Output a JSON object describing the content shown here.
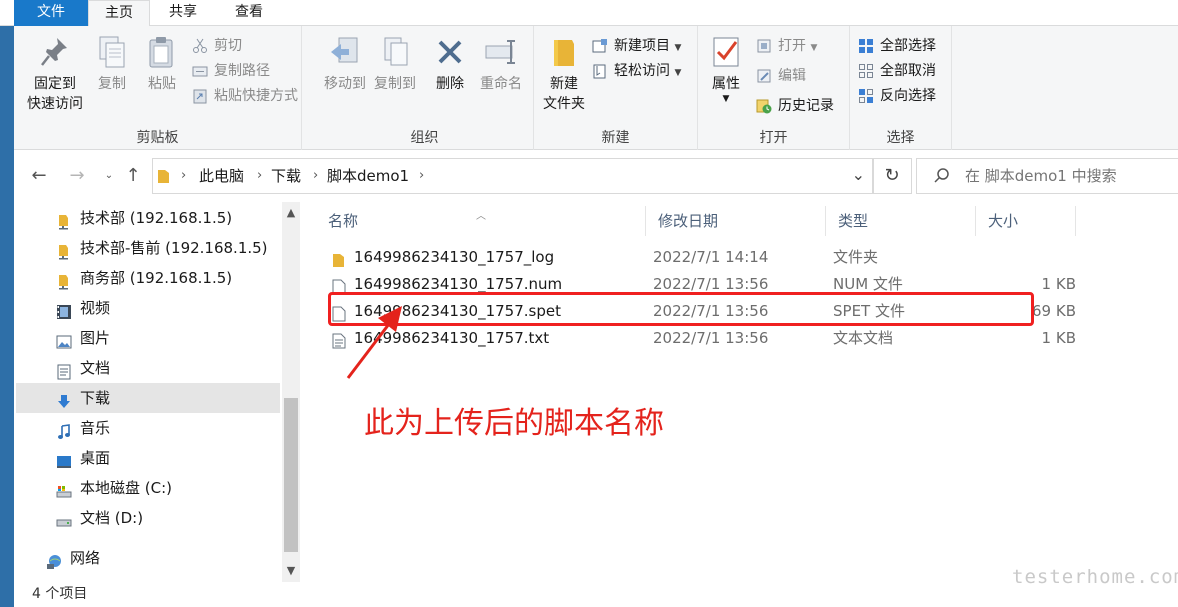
{
  "tabs": {
    "file": "文件",
    "home": "主页",
    "share": "共享",
    "view": "查看"
  },
  "ribbon": {
    "clipboard": {
      "label": "剪贴板",
      "pin": "固定到\n快速访问",
      "pin_l1": "固定到",
      "pin_l2": "快速访问",
      "copy": "复制",
      "paste": "粘贴",
      "cut": "剪切",
      "copy_path": "复制路径",
      "paste_shortcut": "粘贴快捷方式"
    },
    "organize": {
      "label": "组织",
      "move_to": "移动到",
      "copy_to": "复制到",
      "delete": "删除",
      "rename": "重命名"
    },
    "new": {
      "label": "新建",
      "new_folder_l1": "新建",
      "new_folder_l2": "文件夹",
      "new_item": "新建项目",
      "easy_access": "轻松访问"
    },
    "open": {
      "label": "打开",
      "properties": "属性",
      "open": "打开",
      "edit": "编辑",
      "history": "历史记录"
    },
    "select": {
      "label": "选择",
      "select_all": "全部选择",
      "select_none": "全部取消",
      "invert": "反向选择"
    }
  },
  "address": {
    "crumbs": [
      "此电脑",
      "下载",
      "脚本demo1"
    ],
    "search_placeholder": "在 脚本demo1 中搜索"
  },
  "sidebar": {
    "items": [
      {
        "label": "技术部 (192.168.1.5)",
        "icon": "network-folder-icon"
      },
      {
        "label": "技术部-售前 (192.168.1.5)",
        "icon": "network-folder-icon"
      },
      {
        "label": "商务部 (192.168.1.5)",
        "icon": "network-folder-icon"
      },
      {
        "label": "视频",
        "icon": "video-folder-icon"
      },
      {
        "label": "图片",
        "icon": "pictures-folder-icon"
      },
      {
        "label": "文档",
        "icon": "documents-folder-icon"
      },
      {
        "label": "下载",
        "icon": "downloads-folder-icon"
      },
      {
        "label": "音乐",
        "icon": "music-folder-icon"
      },
      {
        "label": "桌面",
        "icon": "desktop-folder-icon"
      },
      {
        "label": "本地磁盘 (C:)",
        "icon": "local-disk-icon"
      },
      {
        "label": "文档 (D:)",
        "icon": "drive-icon"
      },
      {
        "label": "网络",
        "icon": "network-icon"
      }
    ]
  },
  "columns": {
    "name": "名称",
    "date": "修改日期",
    "type": "类型",
    "size": "大小"
  },
  "files": [
    {
      "name": "1649986234130_1757_log",
      "date": "2022/7/1 14:14",
      "type": "文件夹",
      "size": ""
    },
    {
      "name": "1649986234130_1757.num",
      "date": "2022/7/1 13:56",
      "type": "NUM 文件",
      "size": "1 KB"
    },
    {
      "name": "1649986234130_1757.spet",
      "date": "2022/7/1 13:56",
      "type": "SPET 文件",
      "size": "69 KB"
    },
    {
      "name": "1649986234130_1757.txt",
      "date": "2022/7/1 13:56",
      "type": "文本文档",
      "size": "1 KB"
    }
  ],
  "status": {
    "count": "4 个项目"
  },
  "annotation": {
    "text": "此为上传后的脚本名称",
    "color": "#e4231c"
  },
  "watermark": "testerhome.com"
}
